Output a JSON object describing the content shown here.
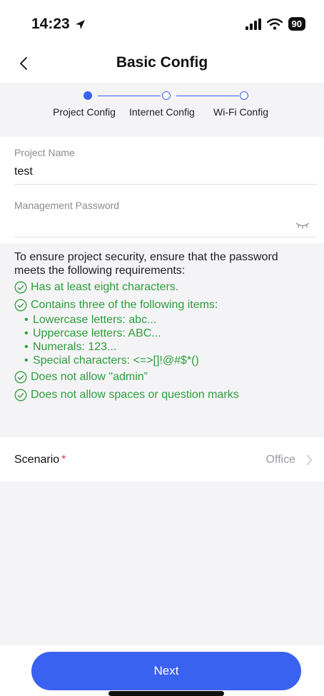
{
  "status_bar": {
    "time": "14:23",
    "battery": "90"
  },
  "nav": {
    "title": "Basic Config"
  },
  "stepper": {
    "steps": [
      "Project Config",
      "Internet Config",
      "Wi-Fi Config"
    ],
    "current": 1
  },
  "form": {
    "project_name_label": "Project Name",
    "project_name_value": "test",
    "password_label": "Management Password",
    "password_value": ""
  },
  "requirements": {
    "intro": "To ensure project security, ensure that the password meets the following requirements:",
    "items": [
      "Has at least eight characters.",
      "Contains three of the following items:",
      "Does not allow \"admin”",
      "Does not allow spaces or question marks"
    ],
    "sub_items": [
      "Lowercase letters: abc...",
      "Uppercase letters: ABC...",
      "Numerals: 123...",
      "Special characters: <=>[]!@#$*()"
    ]
  },
  "scenario": {
    "label": "Scenario",
    "required_mark": "*",
    "value": "Office"
  },
  "footer": {
    "next_label": "Next"
  },
  "colors": {
    "accent": "#3a62f0",
    "success": "#2e9e3b",
    "required": "#e53935",
    "band": "#f4f4f6"
  }
}
